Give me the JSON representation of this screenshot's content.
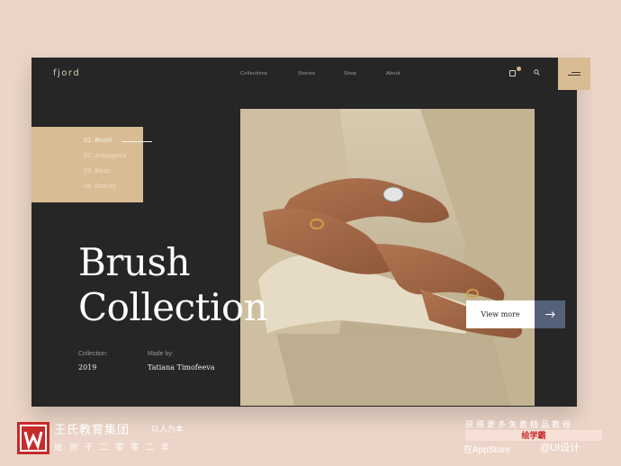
{
  "header": {
    "logo": "fjord",
    "nav": [
      "Collections",
      "Stories",
      "Shop",
      "About"
    ]
  },
  "icons": {
    "bag": "shopping-bag-icon",
    "search": "search-icon",
    "menu": "menu-icon"
  },
  "collections": [
    {
      "num": "01.",
      "name": "Brush"
    },
    {
      "num": "02.",
      "name": "Amalgama"
    },
    {
      "num": "03.",
      "name": "Basic"
    },
    {
      "num": "04.",
      "name": "Gravity"
    }
  ],
  "hero": {
    "title_line1": "Brush",
    "title_line2": "Collection",
    "collection_label": "Collection:",
    "collection_value": "2019",
    "made_by_label": "Made by:",
    "made_by_value": "Tatiana Timofeeva",
    "cta_label": "View more"
  },
  "watermark": {
    "name": "王氏教育集团",
    "slogan": "以人为本",
    "sub": "始创于二零零二年",
    "right_line1": "获得更多免费精品教程",
    "badge": "绘学霸",
    "right_line3": "在AppStore",
    "weibo": "@UI设计"
  },
  "colors": {
    "background": "#ecd5c8",
    "panel": "#262626",
    "accent": "#d9bc93",
    "cta_arrow": "#546178"
  }
}
